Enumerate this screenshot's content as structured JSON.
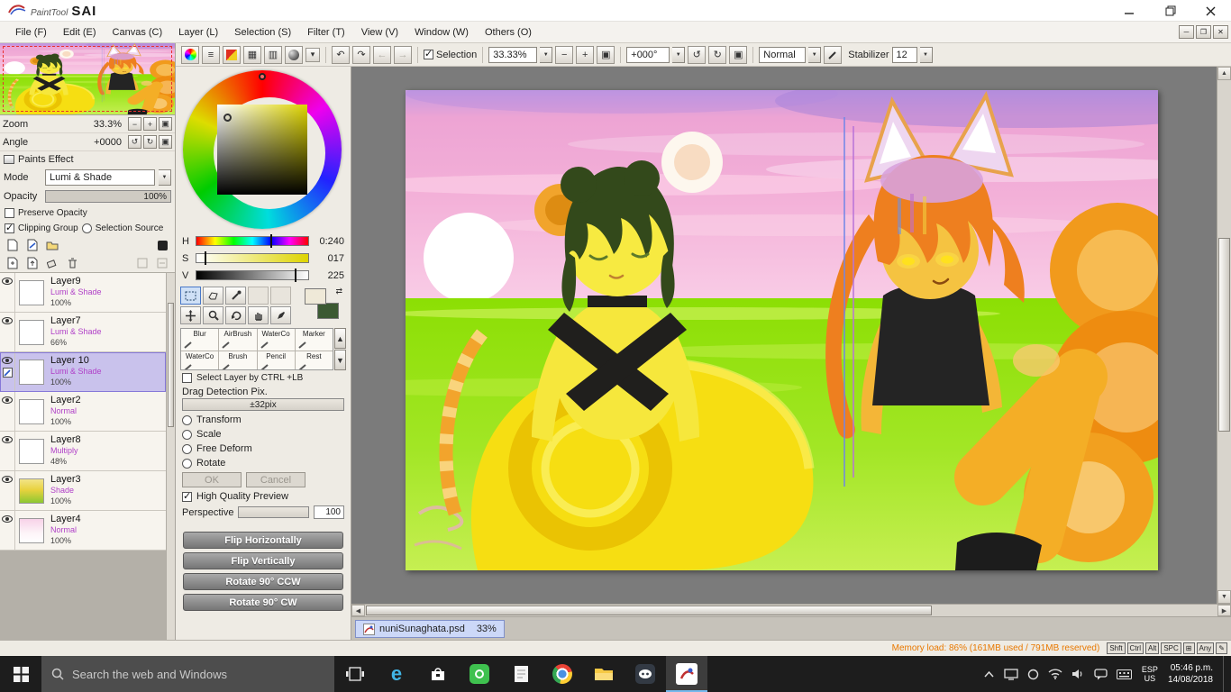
{
  "window": {
    "logo_paint": "PaintTool",
    "logo_sai": "SAI"
  },
  "menu": {
    "items": [
      "File (F)",
      "Edit (E)",
      "Canvas (C)",
      "Layer (L)",
      "Selection (S)",
      "Filter (T)",
      "View (V)",
      "Window (W)",
      "Others (O)"
    ]
  },
  "toolbar": {
    "selection_label": "Selection",
    "zoom": "33.33%",
    "angle": "+000°",
    "blend_mode": "Normal",
    "stabilizer_label": "Stabilizer",
    "stabilizer": "12",
    "icons": [
      "color-wheel",
      "workspace-lines",
      "color-swatches",
      "grid",
      "pixel-grid",
      "sphere",
      "dropdown",
      "undo",
      "redo",
      "prev",
      "next",
      "zoom-out",
      "zoom-in",
      "zoom-reset",
      "rotate-ccw",
      "rotate-cw",
      "angle-reset"
    ]
  },
  "navigator": {
    "zoom_label": "Zoom",
    "zoom": "33.3%",
    "angle_label": "Angle",
    "angle": "+0000"
  },
  "paints_effect": {
    "title": "Paints Effect",
    "mode_label": "Mode",
    "mode": "Lumi & Shade",
    "opacity_label": "Opacity",
    "opacity": "100%",
    "preserve": "Preserve Opacity",
    "clipping": "Clipping Group",
    "sel_source": "Selection Source"
  },
  "layer_toolbar_icons": [
    "new-layer",
    "new-linework-layer",
    "new-folder",
    "layer-mask",
    "copy-layer",
    "transfer-layer",
    "clear-layer",
    "delete-layer"
  ],
  "layers": [
    {
      "name": "Layer9",
      "mode": "Lumi & Shade",
      "opacity": "100%"
    },
    {
      "name": "Layer7",
      "mode": "Lumi & Shade",
      "opacity": "66%"
    },
    {
      "name": "Layer 10",
      "mode": "Lumi & Shade",
      "opacity": "100%"
    },
    {
      "name": "Layer2",
      "mode": "Normal",
      "opacity": "100%"
    },
    {
      "name": "Layer8",
      "mode": "Multiply",
      "opacity": "48%"
    },
    {
      "name": "Layer3",
      "mode": "Shade",
      "opacity": "100%"
    },
    {
      "name": "Layer4",
      "mode": "Normal",
      "opacity": "100%"
    }
  ],
  "color_panel": {
    "h_label": "H",
    "h": "0:240",
    "s_label": "S",
    "s": "017",
    "v_label": "V",
    "v": "225"
  },
  "tool_icons": [
    "rect-select",
    "lasso",
    "eyedropper",
    "move",
    "zoom",
    "rotate-view",
    "hand",
    "pen"
  ],
  "brush_tools": [
    "Blur",
    "AirBrush",
    "WaterCo",
    "Marker",
    "WaterCo",
    "Brush",
    "Pencil",
    "Rest"
  ],
  "options": {
    "select_layer": "Select Layer by CTRL +LB",
    "drag_label": "Drag Detection Pix.",
    "drag_value": "±32pix",
    "radio_transform": "Transform",
    "radio_scale": "Scale",
    "radio_free_deform": "Free Deform",
    "radio_rotate": "Rotate",
    "ok": "OK",
    "cancel": "Cancel",
    "hq": "High Quality Preview",
    "perspective_label": "Perspective",
    "perspective": "100",
    "flip_h": "Flip Horizontally",
    "flip_v": "Flip Vertically",
    "rot_ccw": "Rotate 90° CCW",
    "rot_cw": "Rotate 90° CW"
  },
  "doc": {
    "tab": "nuniSunaghata.psd",
    "zoom": "33%"
  },
  "status": {
    "memory": "Memory load: 86% (161MB used / 791MB reserved)",
    "keys": [
      "Shft",
      "Ctrl",
      "Alt",
      "SPC",
      "Any"
    ]
  },
  "taskbar": {
    "search": "Search the web and Windows",
    "lang1": "ESP",
    "lang2": "US",
    "time": "05:46 p.m.",
    "date": "14/08/2018",
    "apps": [
      "edge",
      "store",
      "green-app",
      "notes-app",
      "chrome",
      "file-explorer",
      "discord",
      "painttool-sai"
    ],
    "tray": [
      "hidden-icons-chevron",
      "display",
      "status-circle",
      "wifi",
      "volume",
      "chat",
      "keyboard"
    ]
  },
  "colors": {
    "selected_layer": "#c9c2ec",
    "layer_mode_text": "#b040c8",
    "memory_text": "#e87800",
    "taskbar_accent": "#76b9ed"
  }
}
